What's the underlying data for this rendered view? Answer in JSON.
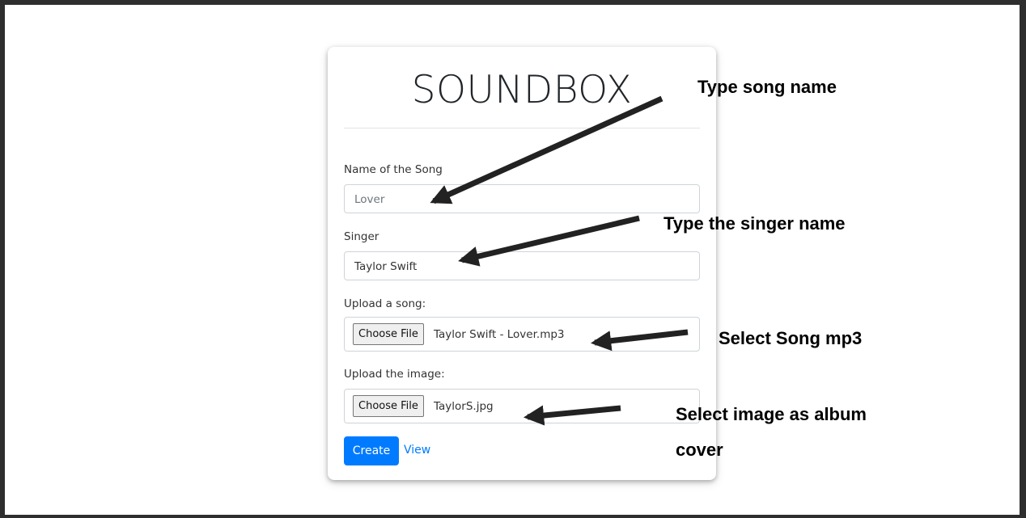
{
  "app": {
    "title": "SOUNDBOX"
  },
  "form": {
    "song_name": {
      "label": "Name of the Song",
      "value": "Lover"
    },
    "singer": {
      "label": "Singer",
      "value": "Taylor Swift"
    },
    "upload_song": {
      "label": "Upload a song:",
      "button_label": "Choose File",
      "file_name": "Taylor Swift - Lover.mp3"
    },
    "upload_image": {
      "label": "Upload the image:",
      "button_label": "Choose File",
      "file_name": "TaylorS.jpg"
    },
    "create_label": "Create",
    "view_label": "View"
  },
  "annotations": {
    "song_name": "Type song name",
    "singer": "Type the singer name",
    "song_file": "Select Song mp3",
    "image_line1": "Select image as album",
    "image_line2": "cover"
  },
  "colors": {
    "primary": "#007bff",
    "border": "#ced4da",
    "frame": "#2e2e2e",
    "arrow": "#222222"
  }
}
